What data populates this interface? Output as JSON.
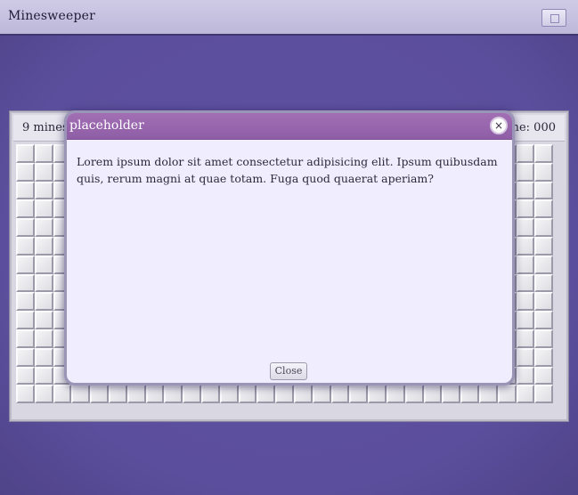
{
  "app": {
    "title": "Minesweeper"
  },
  "board": {
    "status_left": "9 mines",
    "status_right": "Time: 000",
    "columns": 29,
    "rows": 14
  },
  "modal": {
    "title": "placeholder",
    "close_glyph": "×",
    "body": "Lorem ipsum dolor sit amet consectetur adipisicing elit. Ipsum quibusdam quis, rerum magni at quae totam. Fuga quod quaerat aperiam?",
    "footer_button": "Close"
  },
  "colors": {
    "backdrop": "#5e51a0",
    "modal_header": "#9563aa",
    "modal_body": "#f0eefe"
  }
}
